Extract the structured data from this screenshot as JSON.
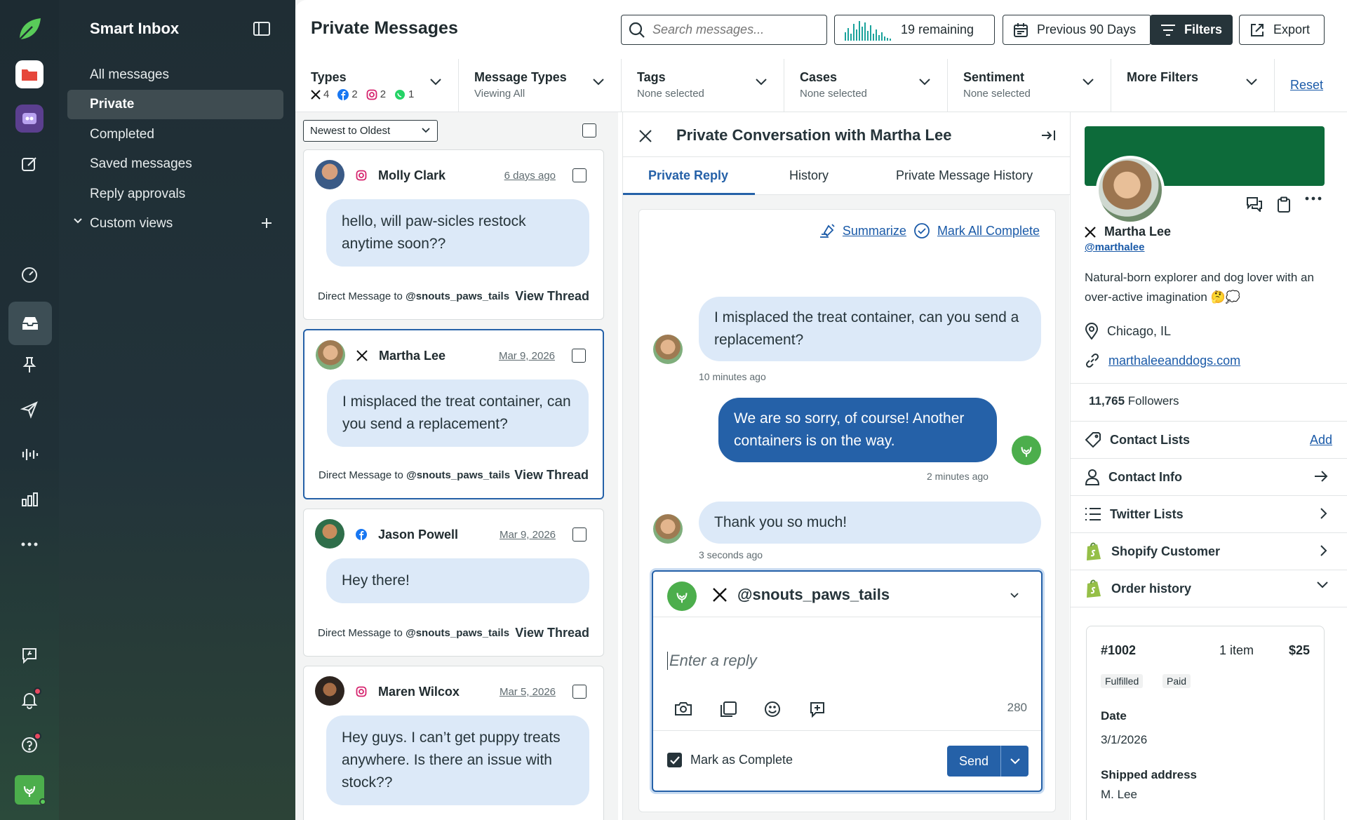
{
  "nav": {
    "title": "Smart Inbox",
    "items": [
      {
        "label": "All messages"
      },
      {
        "label": "Private"
      },
      {
        "label": "Completed"
      },
      {
        "label": "Saved messages"
      },
      {
        "label": "Reply approvals"
      },
      {
        "label": "Custom views"
      }
    ]
  },
  "header": {
    "title": "Private Messages",
    "search_placeholder": "Search messages...",
    "remaining": "19 remaining",
    "date_range": "Previous 90 Days",
    "filters": "Filters",
    "export": "Export"
  },
  "filters": {
    "types": {
      "label": "Types",
      "x": "4",
      "facebook": "2",
      "instagram": "2",
      "whatsapp": "1"
    },
    "message_types": {
      "label": "Message Types",
      "sub": "Viewing All"
    },
    "tags": {
      "label": "Tags",
      "sub": "None selected"
    },
    "cases": {
      "label": "Cases",
      "sub": "None selected"
    },
    "sentiment": {
      "label": "Sentiment",
      "sub": "None selected"
    },
    "more": {
      "label": "More Filters"
    },
    "reset": "Reset"
  },
  "list": {
    "sort": "Newest to Oldest",
    "cards": [
      {
        "name": "Molly Clark",
        "date": "6 days ago",
        "text": "hello, will paw-sicles restock anytime soon??",
        "dm": "Direct Message to",
        "handle": "@snouts_paws_tails",
        "view": "View Thread",
        "network": "instagram"
      },
      {
        "name": "Martha Lee",
        "date": "Mar 9, 2026",
        "text": "I misplaced the treat container, can you send a replacement?",
        "dm": "Direct Message to",
        "handle": "@snouts_paws_tails",
        "view": "View Thread",
        "network": "x"
      },
      {
        "name": "Jason Powell",
        "date": "Mar 9, 2026",
        "text": "Hey there!",
        "dm": "Direct Message to",
        "handle": "@snouts_paws_tails",
        "view": "View Thread",
        "network": "facebook"
      },
      {
        "name": "Maren Wilcox",
        "date": "Mar 5, 2026",
        "text": "Hey guys. I can’t get puppy treats anywhere. Is there an issue with stock??",
        "network": "instagram"
      }
    ]
  },
  "conversation": {
    "title": "Private Conversation with Martha Lee",
    "tabs": [
      "Private Reply",
      "History",
      "Private Message History"
    ],
    "summarize": "Summarize",
    "mark_all": "Mark All Complete",
    "messages": [
      {
        "text": "I misplaced the treat container, can you send a replacement?",
        "time": "10 minutes ago"
      },
      {
        "text": "We are so sorry, of course! Another containers is on the way.",
        "time": "2 minutes ago"
      },
      {
        "text": "Thank you so much!",
        "time": "3 seconds ago"
      }
    ],
    "composer": {
      "account": "@snouts_paws_tails",
      "placeholder": "Enter a reply",
      "count": "280",
      "mark_complete": "Mark as Complete",
      "send": "Send"
    }
  },
  "profile": {
    "name": "Martha Lee",
    "handle": "@marthalee",
    "bio": "Natural-born explorer and dog lover with an over-active imagination 🤔💭",
    "location": "Chicago, IL",
    "website": "marthaleeanddogs.com",
    "followers_count": "11,765",
    "followers_label": "Followers",
    "rows": {
      "contact_lists": "Contact Lists",
      "add": "Add",
      "contact_info": "Contact Info",
      "twitter_lists": "Twitter Lists",
      "shopify": "Shopify Customer",
      "order_history": "Order history"
    },
    "order": {
      "number": "#1002",
      "items": "1 item",
      "price": "$25",
      "status1": "Fulfilled",
      "status2": "Paid",
      "date_label": "Date",
      "date": "3/1/2026",
      "ship_label": "Shipped address",
      "ship": "M. Lee"
    }
  },
  "colors": {
    "accent": "#2561a8",
    "brand_green": "#0d6b3a",
    "bubble_in": "#dce9f8",
    "sidebar": "#1f2d34"
  }
}
